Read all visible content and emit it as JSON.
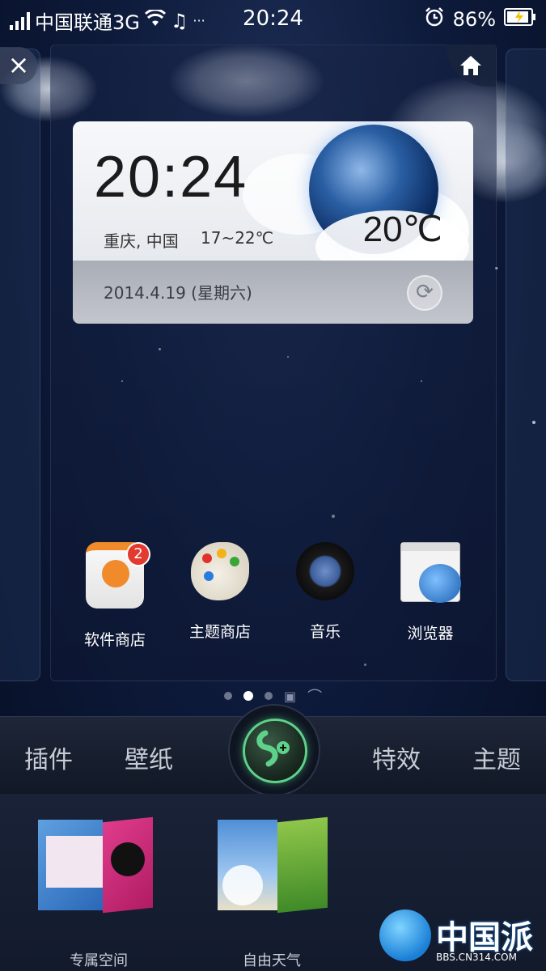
{
  "status_bar": {
    "carrier": "中国联通3G",
    "time": "20:24",
    "battery": "86%"
  },
  "weather_widget": {
    "time": "20:24",
    "location": "重庆, 中国",
    "temp_range": "17~22℃",
    "current_temp": "20℃",
    "date": "2014.4.19 (星期六)"
  },
  "apps": [
    {
      "label": "软件商店",
      "badge": "2",
      "icon": "app-store-icon"
    },
    {
      "label": "主题商店",
      "icon": "theme-store-icon"
    },
    {
      "label": "音乐",
      "icon": "music-icon"
    },
    {
      "label": "浏览器",
      "icon": "browser-icon"
    }
  ],
  "page_indicator": {
    "pages": 3,
    "active": 2
  },
  "menu": {
    "left": [
      "插件",
      "壁纸"
    ],
    "right": [
      "特效",
      "主题"
    ]
  },
  "tray": [
    {
      "label": "专属空间"
    },
    {
      "label": "自由天气"
    }
  ],
  "watermark": {
    "site": "BBS.CN314.COM",
    "brand": "中国派"
  }
}
